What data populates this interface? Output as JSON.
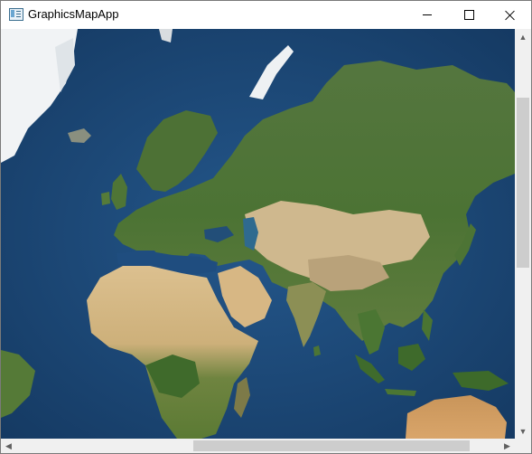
{
  "window": {
    "title": "GraphicsMapApp",
    "minimize_glyph": "",
    "maximize_glyph": "",
    "close_glyph": ""
  },
  "map": {
    "basemap": "satellite imagery",
    "region": "Eurasia and Africa",
    "colors": {
      "ocean": "#1d4a7c",
      "deep_ocean": "#163d69",
      "vegetation": "#4f7a35",
      "forest": "#3d6b2a",
      "desert": "#d9bd8c",
      "ice": "#f2f4f6"
    }
  },
  "scrollbars": {
    "vertical": {
      "up_arrow": "▲",
      "down_arrow": "▼",
      "thumb_fraction": 0.45
    },
    "horizontal": {
      "left_arrow": "◀",
      "right_arrow": "▶",
      "thumb_fraction": 0.57
    }
  },
  "icons": {
    "app": "map-app-icon",
    "minimize": "minimize-icon",
    "maximize": "maximize-icon",
    "close": "close-icon"
  }
}
